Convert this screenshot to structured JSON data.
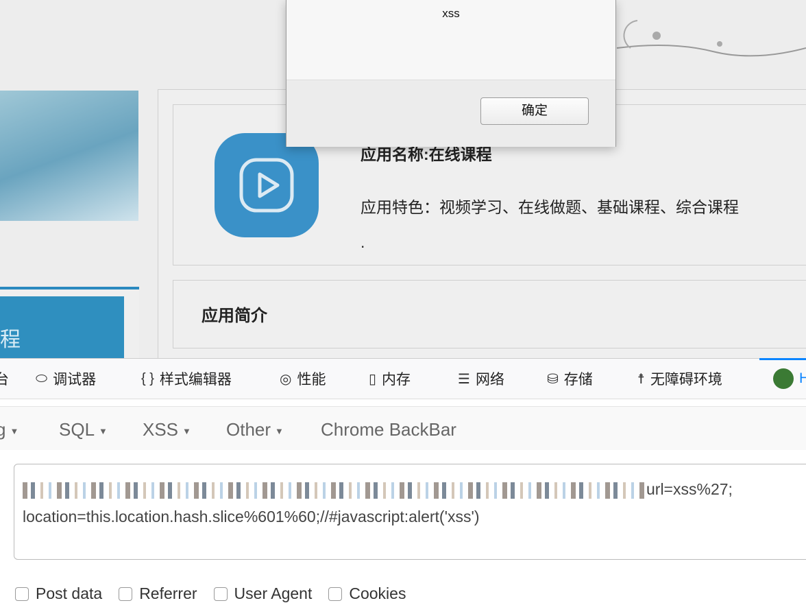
{
  "alert": {
    "message": "xss",
    "ok_label": "确定"
  },
  "webpage": {
    "left_nav_label": "程",
    "app_name": "应用名称:在线课程",
    "app_features": "应用特色：视频学习、在线做题、基础课程、综合课程",
    "dot": ".",
    "section_title": "应用简介"
  },
  "devtools": {
    "tabs": [
      {
        "label": "台",
        "icon": ""
      },
      {
        "label": "调试器",
        "icon": "debugger-icon"
      },
      {
        "label": "样式编辑器",
        "icon": "braces-icon"
      },
      {
        "label": "性能",
        "icon": "performance-icon"
      },
      {
        "label": "内存",
        "icon": "memory-icon"
      },
      {
        "label": "网络",
        "icon": "network-icon"
      },
      {
        "label": "存储",
        "icon": "storage-icon"
      },
      {
        "label": "无障碍环境",
        "icon": "accessibility-icon"
      },
      {
        "label": "H",
        "icon": "hackbar-icon"
      }
    ],
    "active_color": "#0a84ff"
  },
  "hackbar": {
    "menus": [
      "g",
      "SQL",
      "XSS",
      "Other"
    ],
    "chrome_backbar": "Chrome BackBar",
    "url_line1_visible": "url=xss%27;",
    "url_line2": "location=this.location.hash.slice%601%60;//#javascript:alert('xss')",
    "options": [
      "Post data",
      "Referrer",
      "User Agent",
      "Cookies"
    ]
  }
}
